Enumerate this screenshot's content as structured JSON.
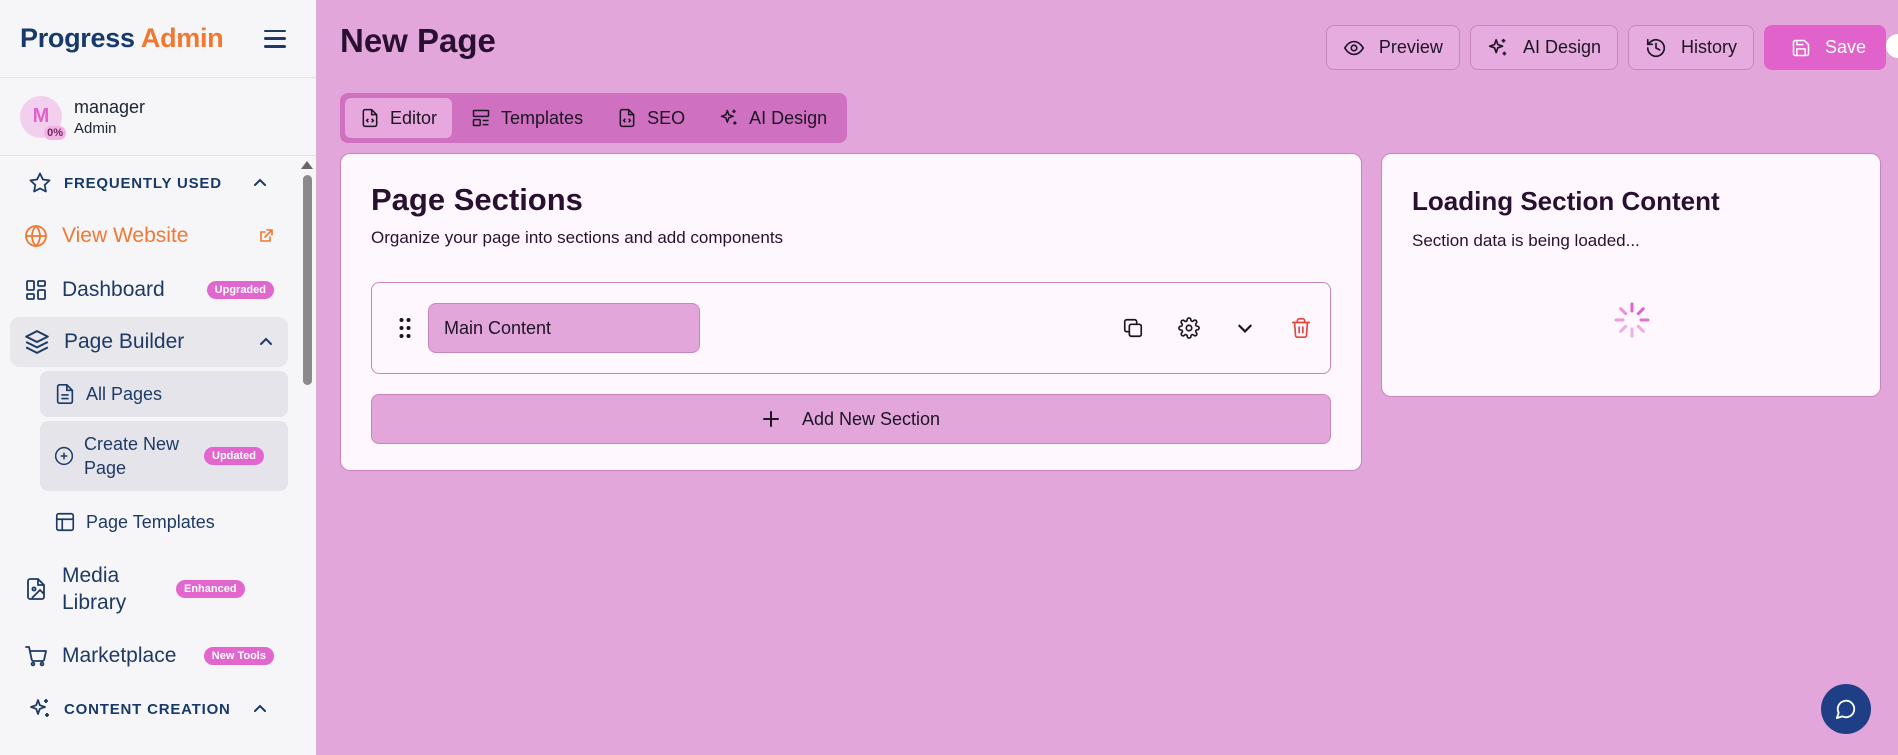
{
  "app": {
    "brand_main": "Progress",
    "brand_accent": "Admin"
  },
  "user": {
    "initial": "M",
    "progress": "0%",
    "name": "manager",
    "role": "Admin"
  },
  "sidebar": {
    "frequently_used": "FREQUENTLY USED",
    "view_website": "View Website",
    "dashboard": {
      "label": "Dashboard",
      "badge": "Upgraded"
    },
    "page_builder": "Page Builder",
    "all_pages": "All Pages",
    "create_new_page": {
      "label": "Create New Page",
      "badge": "Updated"
    },
    "page_templates": "Page Templates",
    "media_library": {
      "label": "Media Library",
      "badge": "Enhanced"
    },
    "marketplace": {
      "label": "Marketplace",
      "badge": "New Tools"
    },
    "content_creation": "CONTENT CREATION"
  },
  "page": {
    "title": "New Page",
    "actions": {
      "preview": "Preview",
      "ai_design": "AI Design",
      "history": "History",
      "save": "Save"
    },
    "tabs": [
      "Editor",
      "Templates",
      "SEO",
      "AI Design"
    ]
  },
  "sections_card": {
    "title": "Page Sections",
    "subtitle": "Organize your page into sections and add components",
    "section_name": "Main Content",
    "add_label": "Add New Section"
  },
  "loading_card": {
    "title": "Loading Section Content",
    "subtitle": "Section data is being loaded..."
  },
  "colors": {
    "main_bg": "#e3a6db",
    "accent": "#e262cc",
    "brand_orange": "#f07832",
    "navy": "#173a6a"
  }
}
